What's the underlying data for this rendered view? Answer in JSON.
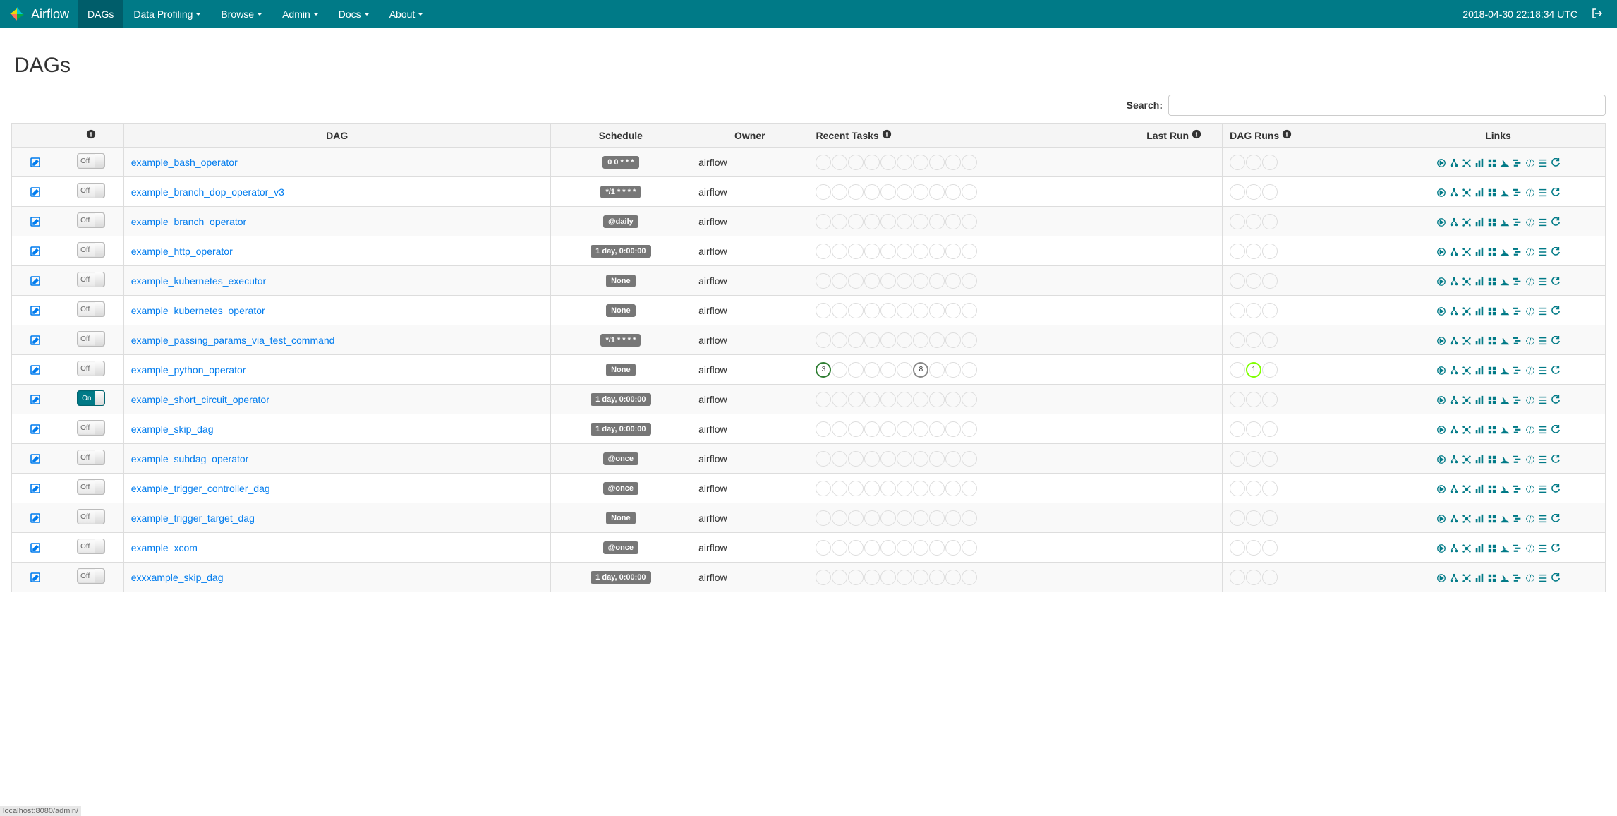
{
  "brand": "Airflow",
  "nav_items": [
    {
      "label": "DAGs",
      "active": true,
      "dropdown": false
    },
    {
      "label": "Data Profiling",
      "active": false,
      "dropdown": true
    },
    {
      "label": "Browse",
      "active": false,
      "dropdown": true
    },
    {
      "label": "Admin",
      "active": false,
      "dropdown": true
    },
    {
      "label": "Docs",
      "active": false,
      "dropdown": true
    },
    {
      "label": "About",
      "active": false,
      "dropdown": true
    }
  ],
  "clock": "2018-04-30 22:18:34 UTC",
  "page_title": "DAGs",
  "search_label": "Search:",
  "search_value": "",
  "columns": {
    "dag": "DAG",
    "schedule": "Schedule",
    "owner": "Owner",
    "recent": "Recent Tasks",
    "lastrun": "Last Run",
    "dagruns": "DAG Runs",
    "links": "Links"
  },
  "toggle_on_label": "On",
  "toggle_off_label": "Off",
  "dags": [
    {
      "name": "example_bash_operator",
      "on": false,
      "schedule": "0 0 * * *",
      "owner": "airflow",
      "recent": [
        null,
        null,
        null,
        null,
        null,
        null,
        null,
        null,
        null,
        null
      ],
      "dagruns": [
        null,
        null,
        null
      ]
    },
    {
      "name": "example_branch_dop_operator_v3",
      "on": false,
      "schedule": "*/1 * * * *",
      "owner": "airflow",
      "recent": [
        null,
        null,
        null,
        null,
        null,
        null,
        null,
        null,
        null,
        null
      ],
      "dagruns": [
        null,
        null,
        null
      ]
    },
    {
      "name": "example_branch_operator",
      "on": false,
      "schedule": "@daily",
      "owner": "airflow",
      "recent": [
        null,
        null,
        null,
        null,
        null,
        null,
        null,
        null,
        null,
        null
      ],
      "dagruns": [
        null,
        null,
        null
      ]
    },
    {
      "name": "example_http_operator",
      "on": false,
      "schedule": "1 day, 0:00:00",
      "owner": "airflow",
      "recent": [
        null,
        null,
        null,
        null,
        null,
        null,
        null,
        null,
        null,
        null
      ],
      "dagruns": [
        null,
        null,
        null
      ]
    },
    {
      "name": "example_kubernetes_executor",
      "on": false,
      "schedule": "None",
      "owner": "airflow",
      "recent": [
        null,
        null,
        null,
        null,
        null,
        null,
        null,
        null,
        null,
        null
      ],
      "dagruns": [
        null,
        null,
        null
      ]
    },
    {
      "name": "example_kubernetes_operator",
      "on": false,
      "schedule": "None",
      "owner": "airflow",
      "recent": [
        null,
        null,
        null,
        null,
        null,
        null,
        null,
        null,
        null,
        null
      ],
      "dagruns": [
        null,
        null,
        null
      ]
    },
    {
      "name": "example_passing_params_via_test_command",
      "on": false,
      "schedule": "*/1 * * * *",
      "owner": "airflow",
      "recent": [
        null,
        null,
        null,
        null,
        null,
        null,
        null,
        null,
        null,
        null
      ],
      "dagruns": [
        null,
        null,
        null
      ]
    },
    {
      "name": "example_python_operator",
      "on": false,
      "schedule": "None",
      "owner": "airflow",
      "recent": [
        {
          "n": 3,
          "cls": "success"
        },
        null,
        null,
        null,
        null,
        null,
        {
          "n": 8,
          "cls": "queued"
        },
        null,
        null,
        null
      ],
      "dagruns": [
        null,
        {
          "n": 1,
          "cls": "running-lime"
        },
        null
      ]
    },
    {
      "name": "example_short_circuit_operator",
      "on": true,
      "schedule": "1 day, 0:00:00",
      "owner": "airflow",
      "recent": [
        null,
        null,
        null,
        null,
        null,
        null,
        null,
        null,
        null,
        null
      ],
      "dagruns": [
        null,
        null,
        null
      ]
    },
    {
      "name": "example_skip_dag",
      "on": false,
      "schedule": "1 day, 0:00:00",
      "owner": "airflow",
      "recent": [
        null,
        null,
        null,
        null,
        null,
        null,
        null,
        null,
        null,
        null
      ],
      "dagruns": [
        null,
        null,
        null
      ]
    },
    {
      "name": "example_subdag_operator",
      "on": false,
      "schedule": "@once",
      "owner": "airflow",
      "recent": [
        null,
        null,
        null,
        null,
        null,
        null,
        null,
        null,
        null,
        null
      ],
      "dagruns": [
        null,
        null,
        null
      ]
    },
    {
      "name": "example_trigger_controller_dag",
      "on": false,
      "schedule": "@once",
      "owner": "airflow",
      "recent": [
        null,
        null,
        null,
        null,
        null,
        null,
        null,
        null,
        null,
        null
      ],
      "dagruns": [
        null,
        null,
        null
      ]
    },
    {
      "name": "example_trigger_target_dag",
      "on": false,
      "schedule": "None",
      "owner": "airflow",
      "recent": [
        null,
        null,
        null,
        null,
        null,
        null,
        null,
        null,
        null,
        null
      ],
      "dagruns": [
        null,
        null,
        null
      ]
    },
    {
      "name": "example_xcom",
      "on": false,
      "schedule": "@once",
      "owner": "airflow",
      "recent": [
        null,
        null,
        null,
        null,
        null,
        null,
        null,
        null,
        null,
        null
      ],
      "dagruns": [
        null,
        null,
        null
      ]
    },
    {
      "name": "exxxample_skip_dag",
      "on": false,
      "schedule": "1 day, 0:00:00",
      "owner": "airflow",
      "recent": [
        null,
        null,
        null,
        null,
        null,
        null,
        null,
        null,
        null,
        null
      ],
      "dagruns": [
        null,
        null,
        null
      ]
    }
  ],
  "link_icons": [
    "trigger",
    "tree",
    "graph",
    "duration",
    "tries",
    "landing",
    "gantt",
    "code",
    "logs",
    "refresh"
  ],
  "status_url": "localhost:8080/admin/"
}
